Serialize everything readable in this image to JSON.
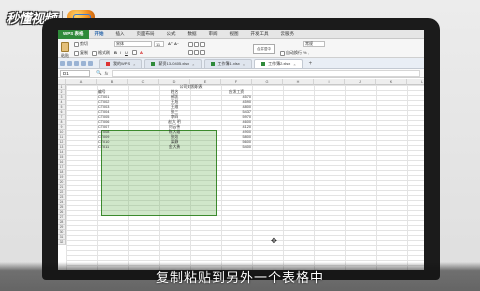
{
  "branding": {
    "site_name": "秒懂视频"
  },
  "subtitle": "复制粘贴到另外一个表格中",
  "menu": {
    "app_button": "WPS 表格",
    "items": [
      "开始",
      "插入",
      "页面布局",
      "公式",
      "数据",
      "审阅",
      "视图",
      "开发工具",
      "云服务"
    ],
    "active_index": 0
  },
  "ribbon": {
    "paste_label": "粘贴",
    "cut_label": "剪切",
    "copy_label": "复制",
    "format_painter_label": "格式刷",
    "font_name": "宋体",
    "font_size": "11",
    "merge_label": "合并居中",
    "wrap_label": "自动换行",
    "number_format": "常规",
    "percent_label": "% ,"
  },
  "tabs": {
    "items": [
      {
        "label": "我的WPS",
        "icon": "wps-icon",
        "active": false
      },
      {
        "label": "薪资13-0405.xlsx",
        "icon": "excel-icon",
        "active": false
      },
      {
        "label": "工作簿1.xlsx",
        "icon": "excel-icon",
        "active": false
      },
      {
        "label": "工作簿2.xlsx",
        "icon": "excel-icon",
        "active": true
      }
    ],
    "new_tab_label": "+"
  },
  "formula_bar": {
    "name_box": "D1",
    "fx_label": "fx"
  },
  "sheet": {
    "columns": [
      "A",
      "B",
      "C",
      "D",
      "E",
      "F",
      "G",
      "H",
      "I",
      "J",
      "K",
      "L"
    ],
    "rows": [
      "1",
      "2",
      "3",
      "4",
      "5",
      "6",
      "7",
      "8",
      "9",
      "10",
      "11",
      "12",
      "13",
      "14",
      "15",
      "16",
      "17",
      "18",
      "19",
      "20",
      "21",
      "22",
      "23",
      "24",
      "25",
      "26",
      "27",
      "28",
      "29",
      "30",
      "31",
      "32"
    ],
    "table_title": "公司对照职表",
    "headers": {
      "code": "编号",
      "name": "姓名",
      "salary": "应发工资"
    },
    "records": [
      {
        "code": "CT001",
        "name": "郝凯",
        "salary": "4570"
      },
      {
        "code": "CT002",
        "name": "王旭",
        "salary": "4590"
      },
      {
        "code": "CT003",
        "name": "王维",
        "salary": "4800"
      },
      {
        "code": "CT004",
        "name": "张三",
        "salary": "5437"
      },
      {
        "code": "CT005",
        "name": "李四",
        "salary": "5970"
      },
      {
        "code": "CT006",
        "name": "赵大 明",
        "salary": "4600"
      },
      {
        "code": "CT007",
        "name": "刘云伟",
        "salary": "4120"
      },
      {
        "code": "CT008",
        "name": "陈大雄",
        "salary": "4900"
      },
      {
        "code": "CT009",
        "name": "张炫",
        "salary": "5800"
      },
      {
        "code": "CT010",
        "name": "梁静",
        "salary": "5600"
      },
      {
        "code": "CT011",
        "name": "金大勇",
        "salary": "5400"
      }
    ]
  }
}
